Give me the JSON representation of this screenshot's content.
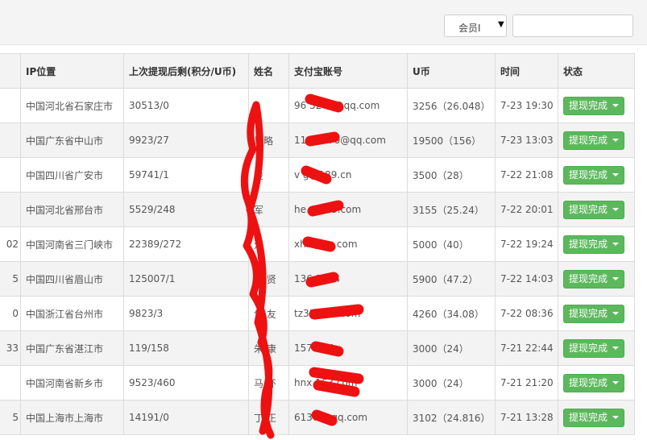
{
  "filter": {
    "select_value": "会员I",
    "search_value": ""
  },
  "columns": [
    "",
    "IP位置",
    "上次提现后剩(积分/U币)",
    "姓名",
    "支付宝账号",
    "U币",
    "时间",
    "状态"
  ],
  "rows": [
    {
      "c0": "",
      "ip": "中国河北省石家庄市",
      "rest": "30513/0",
      "name": "",
      "alipay": "96    5247@qq.com",
      "ub": "3256（26.048）",
      "time": "7-23 19:30",
      "status": "提现完成"
    },
    {
      "c0": "",
      "ip": "中国广东省中山市",
      "rest": "9923/27",
      "name": "  恩略",
      "alipay": "11    16370@qq.com",
      "ub": "19500（156）",
      "time": "7-23 13:03",
      "status": "提现完成"
    },
    {
      "c0": "",
      "ip": "中国四川省广安市",
      "rest": "59741/1",
      "name": "  俊",
      "alipay": "v     g@189.cn",
      "ub": "3500（28）",
      "time": "7-22 21:08",
      "status": "提现完成"
    },
    {
      "c0": "",
      "ip": "中国河北省邢台市",
      "rest": "5529/248",
      "name": "  军",
      "alipay": "he        @163.com",
      "ub": "3155（25.24）",
      "time": "7-22 20:01",
      "status": "提现完成"
    },
    {
      "c0": "02",
      "ip": "中国河南省三门峡市",
      "rest": "22389/272",
      "name": "  洁",
      "alipay": "xhl      @qq.com",
      "ub": "5000（40）",
      "time": "7-22 19:24",
      "status": "提现完成"
    },
    {
      "c0": "5",
      "ip": "中国四川省眉山市",
      "rest": "125007/1",
      "name": "谢  贤",
      "alipay": "136      5264",
      "ub": "5900（47.2）",
      "time": "7-22 14:03",
      "status": "提现完成"
    },
    {
      "c0": "0",
      "ip": "中国浙江省台州市",
      "rest": "9823/3",
      "name": "包  友",
      "alipay": "tz31      163.com",
      "ub": "4260（34.08）",
      "time": "7-22 08:36",
      "status": "提现完成"
    },
    {
      "c0": "33",
      "ip": "中国广东省湛江市",
      "rest": "119/158",
      "name": "朱  康",
      "alipay": "157      314",
      "ub": "3000（24）",
      "time": "7-21 22:44",
      "status": "提现完成"
    },
    {
      "c0": "",
      "ip": "中国河南省新乡市",
      "rest": "9523/460",
      "name": "马  环",
      "alipay": "hnx        163.com",
      "ub": "3000（24）",
      "time": "7-21 21:20",
      "status": "提现完成"
    },
    {
      "c0": "5",
      "ip": "中国上海市上海市",
      "rest": "14191/0",
      "name": "丁  正",
      "alipay": "6137      @qq.com",
      "ub": "3102（24.816）",
      "time": "7-21 13:28",
      "status": "提现完成"
    }
  ],
  "colors": {
    "status_green": "#5cb85c",
    "redaction": "#ee1111"
  }
}
